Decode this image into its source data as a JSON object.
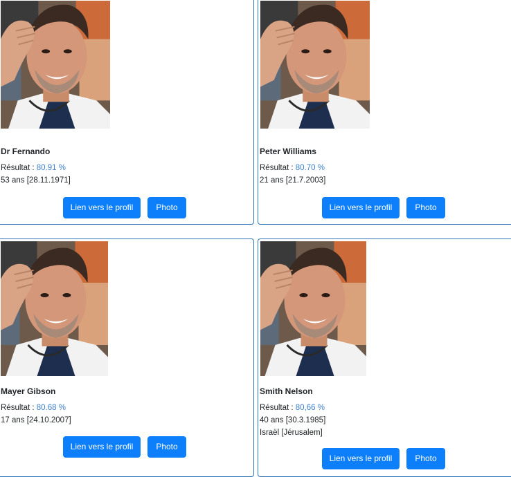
{
  "results": [
    {
      "name": "Dr Fernando",
      "result_label": "Résultat : ",
      "result_value": "80.91 %",
      "age_line": "53 ans [28.11.1971]",
      "profile_button": "Lien vers le profil",
      "photo_button": "Photo"
    },
    {
      "name": "Peter Williams",
      "result_label": "Résultat : ",
      "result_value": "80.70 %",
      "age_line": "21 ans [21.7.2003]",
      "profile_button": "Lien vers le profil",
      "photo_button": "Photo"
    },
    {
      "name": "Mayer Gibson",
      "result_label": "Résultat : ",
      "result_value": "80.68 %",
      "age_line": "17 ans [24.10.2007]",
      "profile_button": "Lien vers le profil",
      "photo_button": "Photo"
    },
    {
      "name": "Smith Nelson",
      "result_label": "Résultat : ",
      "result_value": "80,66 %",
      "age_line": "40 ans [30.3.1985]",
      "location_line": "Israël [Jérusalem]",
      "profile_button": "Lien vers le profil",
      "photo_button": "Photo"
    }
  ],
  "colors": {
    "card_border": "#2f73b8",
    "button_bg": "#0d7ffb",
    "result_value": "#3d7fcf"
  }
}
